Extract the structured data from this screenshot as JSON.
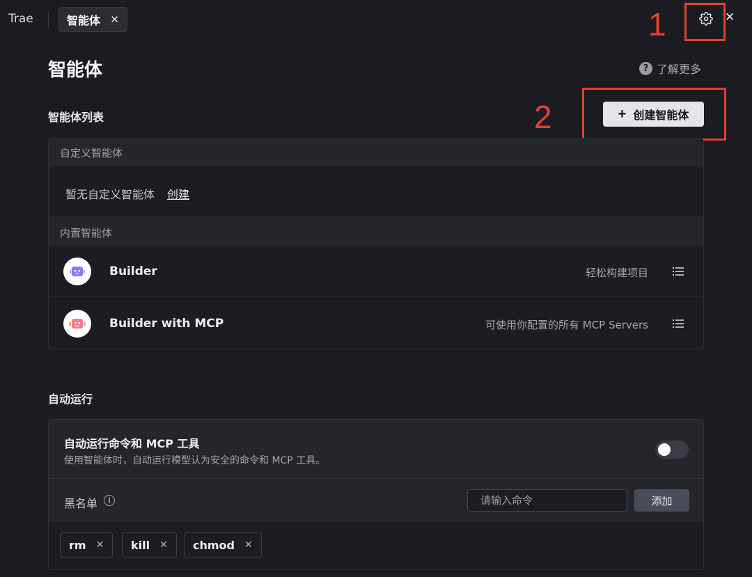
{
  "topbar": {
    "app_name": "Trae",
    "tab": {
      "label": "智能体",
      "close_glyph": "✕"
    },
    "close_glyph": "✕",
    "gear_icon": "gear-icon"
  },
  "annotations": {
    "first": "1",
    "second": "2",
    "color": "#e0422f"
  },
  "header": {
    "title": "智能体",
    "learn_more_icon": "?",
    "learn_more": "了解更多"
  },
  "agents_section": {
    "title": "智能体列表",
    "create_button": {
      "icon": "+",
      "label": "创建智能体"
    },
    "custom_group": {
      "header": "自定义智能体",
      "empty_text": "暂无自定义智能体",
      "create_link": "创建"
    },
    "builtin_group": {
      "header": "内置智能体",
      "items": [
        {
          "name": "Builder",
          "desc": "轻松构建项目",
          "avatar_color": "#8b7cf6"
        },
        {
          "name": "Builder with MCP",
          "desc": "可使用你配置的所有 MCP Servers",
          "avatar_color": "#f47b8c"
        }
      ]
    }
  },
  "auto_run_section": {
    "title": "自动运行",
    "setting_title": "自动运行命令和 MCP 工具",
    "setting_desc": "使用智能体时，自动运行模型认为安全的命令和 MCP 工具。",
    "toggle_on": false,
    "blacklist": {
      "label": "黑名单",
      "info_icon": "i",
      "input_placeholder": "请输入命令",
      "add_button": "添加",
      "chips": [
        {
          "label": "rm",
          "close": "✕"
        },
        {
          "label": "kill",
          "close": "✕"
        },
        {
          "label": "chmod",
          "close": "✕"
        }
      ]
    }
  }
}
